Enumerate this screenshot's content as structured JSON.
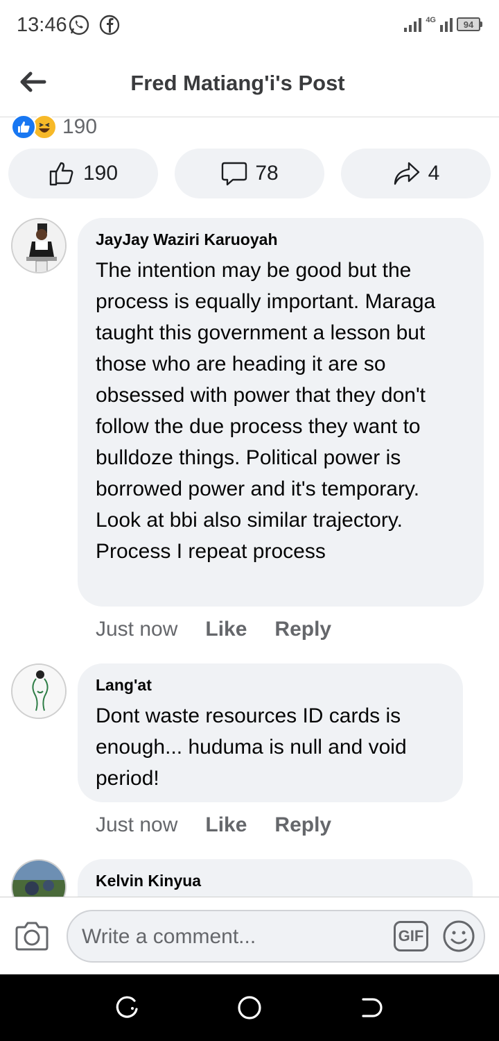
{
  "status_bar": {
    "time": "13:46",
    "network": "4G",
    "battery": "94",
    "icons": [
      "whatsapp-icon",
      "facebook-icon",
      "signal-icon",
      "battery-icon"
    ]
  },
  "header": {
    "title": "Fred Matiang'i's Post",
    "back_icon": "back-arrow-icon"
  },
  "reactions": {
    "types": [
      "like",
      "haha"
    ],
    "count": "190"
  },
  "actions": {
    "like_count": "190",
    "comment_count": "78",
    "share_count": "4"
  },
  "comments": [
    {
      "author": "JayJay Waziri Karuoyah",
      "text": "The intention may be good but the process is equally important. Maraga taught this government a lesson but those who are heading it are so obsessed with power that they don't follow the due process they want to bulldoze things. Political power is borrowed power and it's temporary. Look at bbi also similar trajectory.\nProcess I repeat process",
      "time": "Just now",
      "like_label": "Like",
      "reply_label": "Reply"
    },
    {
      "author": "Lang'at",
      "text": "Dont waste resources ID cards is enough... huduma is null and void period!",
      "time": "Just now",
      "like_label": "Like",
      "reply_label": "Reply"
    },
    {
      "author": "Kelvin Kinyua"
    }
  ],
  "composer": {
    "placeholder": "Write a comment...",
    "gif_label": "GIF"
  },
  "colors": {
    "accent": "#1877f2",
    "bubble": "#f0f2f5",
    "secondary_text": "#65676b"
  }
}
